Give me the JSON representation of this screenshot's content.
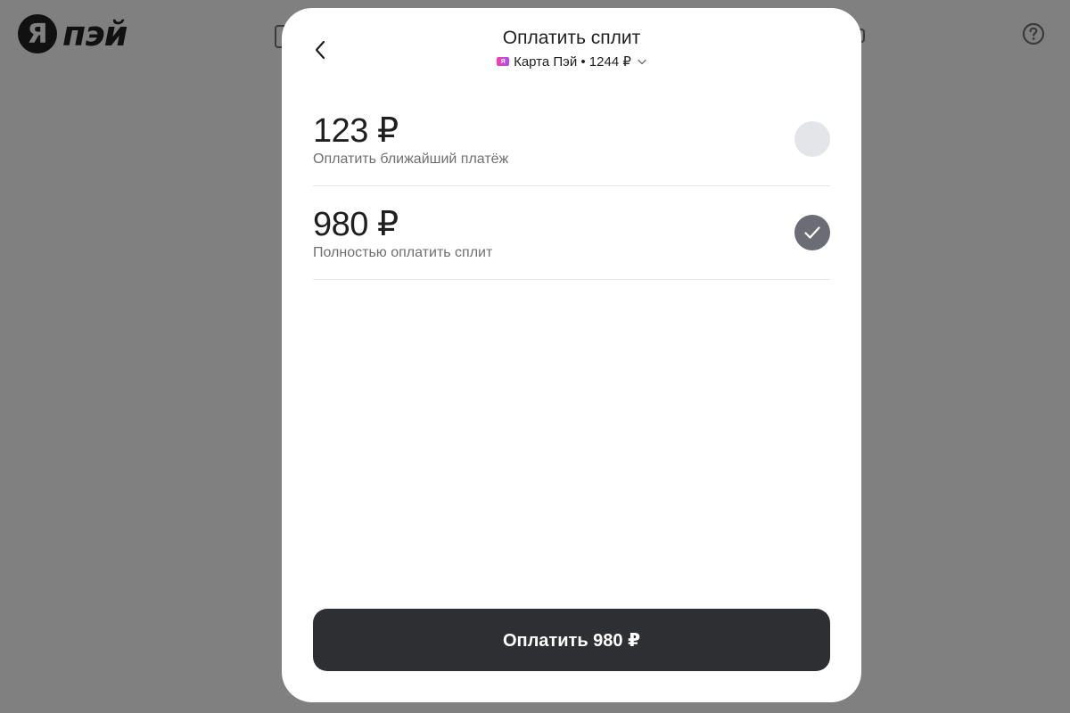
{
  "brand": {
    "logo_letter": "Я",
    "logo_text": "пэй"
  },
  "modal": {
    "title": "Оплатить сплит",
    "card": {
      "badge": "Я",
      "label": "Карта Пэй • 1244 ₽"
    },
    "options": [
      {
        "amount": "123 ₽",
        "description": "Оплатить ближайший платёж",
        "selected": false
      },
      {
        "amount": "980 ₽",
        "description": "Полностью оплатить сплит",
        "selected": true
      }
    ],
    "pay_button": "Оплатить 980 ₽"
  },
  "icons": {
    "back": "chevron-left-icon",
    "dropdown": "chevron-down-icon",
    "check": "check-icon",
    "help": "question-circle-icon"
  },
  "colors": {
    "overlay": "#808080",
    "button": "#2e2f33",
    "radio_checked": "#6b6c75",
    "radio_unchecked": "#e4e5e9"
  }
}
